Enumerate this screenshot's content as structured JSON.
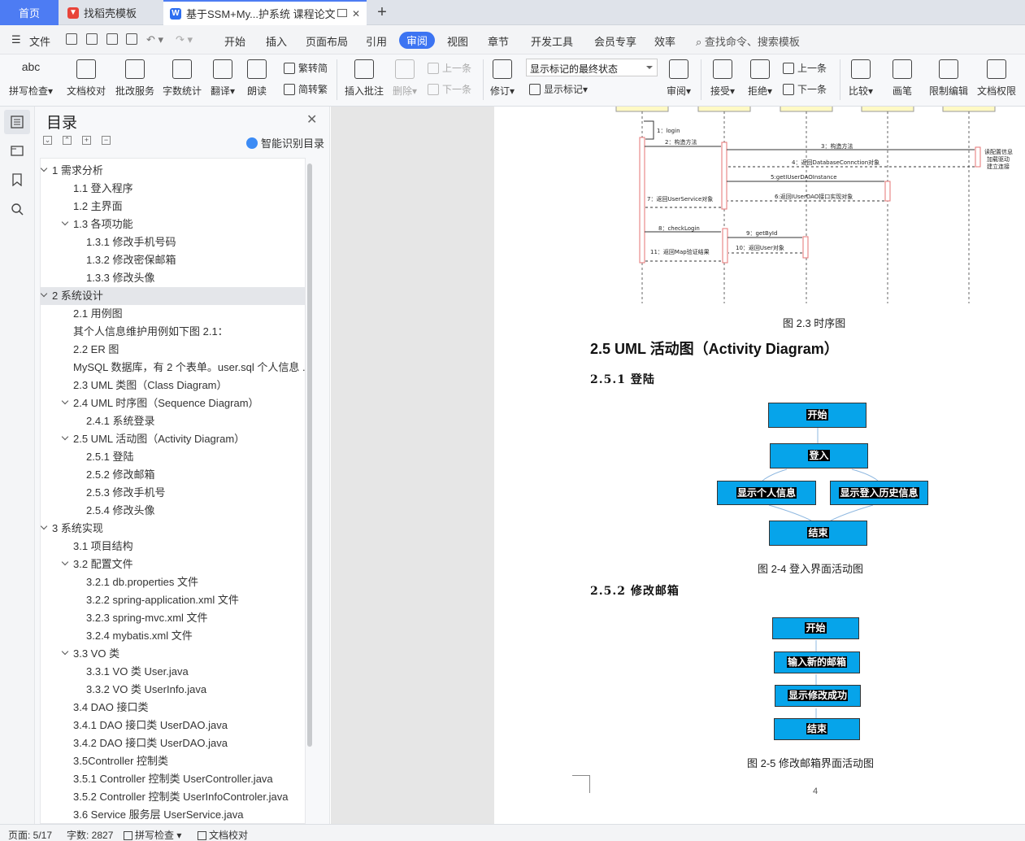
{
  "tabs": {
    "home": "首页",
    "template": "找稻壳模板",
    "doc": "基于SSM+My...护系统 课程论文"
  },
  "menu": {
    "file": "文件",
    "items": [
      "开始",
      "插入",
      "页面布局",
      "引用",
      "审阅",
      "视图",
      "章节",
      "开发工具",
      "会员专享",
      "效率"
    ],
    "search": "查找命令、搜索模板"
  },
  "ribbon": {
    "spell": "拼写检查",
    "proof": "文档校对",
    "batch": "批改服务",
    "wordcount": "字数统计",
    "translate": "翻译",
    "read": "朗读",
    "t2s": "繁转简",
    "s2t": "简转繁",
    "insert_comment": "插入批注",
    "delete": "删除",
    "prev": "上一条",
    "next": "下一条",
    "revise": "修订",
    "markup_state": "显示标记的最终状态",
    "show_markup": "显示标记",
    "review": "审阅",
    "accept": "接受",
    "reject": "拒绝",
    "prev2": "上一条",
    "next2": "下一条",
    "compare": "比较",
    "pen": "画笔",
    "restrict": "限制编辑",
    "permission": "文档权限"
  },
  "toc": {
    "title": "目录",
    "smart": "智能识别目录",
    "items": [
      {
        "label": "1  需求分析",
        "level": 0,
        "caret": true
      },
      {
        "label": "1.1 登入程序",
        "level": 1
      },
      {
        "label": "1.2 主界面",
        "level": 1
      },
      {
        "label": "1.3 各项功能",
        "level": 1,
        "caret": true
      },
      {
        "label": "1.3.1  修改手机号码",
        "level": 2
      },
      {
        "label": "1.3.2  修改密保邮箱",
        "level": 2
      },
      {
        "label": "1.3.3  修改头像",
        "level": 2
      },
      {
        "label": "2  系统设计",
        "level": 0,
        "caret": true,
        "highlight": true
      },
      {
        "label": "2.1 用例图",
        "level": 1
      },
      {
        "label": "其个人信息维护用例如下图 2.1：",
        "level": 1
      },
      {
        "label": "2.2 ER 图",
        "level": 1
      },
      {
        "label": "MySQL 数据库，有 2 个表单。user.sql 个人信息 ...",
        "level": 1
      },
      {
        "label": "2.3 UML 类图（Class Diagram）",
        "level": 1
      },
      {
        "label": "2.4 UML 时序图（Sequence Diagram）",
        "level": 1,
        "caret": true
      },
      {
        "label": "2.4.1  系统登录",
        "level": 2
      },
      {
        "label": "2.5 UML 活动图（Activity Diagram）",
        "level": 1,
        "caret": true
      },
      {
        "label": "2.5.1  登陆",
        "level": 2
      },
      {
        "label": "2.5.2  修改邮箱",
        "level": 2
      },
      {
        "label": "2.5.3  修改手机号",
        "level": 2
      },
      {
        "label": "2.5.4  修改头像",
        "level": 2
      },
      {
        "label": "3  系统实现",
        "level": 0,
        "caret": true
      },
      {
        "label": "3.1  项目结构",
        "level": 1
      },
      {
        "label": "3.2  配置文件",
        "level": 1,
        "caret": true
      },
      {
        "label": "3.2.1 db.properties 文件",
        "level": 2
      },
      {
        "label": "3.2.2 spring-application.xml 文件",
        "level": 2
      },
      {
        "label": "3.2.3 spring-mvc.xml 文件",
        "level": 2
      },
      {
        "label": "3.2.4 mybatis.xml 文件",
        "level": 2
      },
      {
        "label": "3.3 VO 类",
        "level": 1,
        "caret": true
      },
      {
        "label": "3.3.1    VO 类 User.java",
        "level": 2
      },
      {
        "label": "3.3.2    VO 类 UserInfo.java",
        "level": 2
      },
      {
        "label": "3.4 DAO 接口类",
        "level": 1
      },
      {
        "label": "3.4.1 DAO 接口类 UserDAO.java",
        "level": 1
      },
      {
        "label": "3.4.2 DAO 接口类 UserDAO.java",
        "level": 1
      },
      {
        "label": "3.5Controller 控制类",
        "level": 1
      },
      {
        "label": "3.5.1 Controller 控制类 UserController.java",
        "level": 1
      },
      {
        "label": "3.5.2 Controller 控制类 UserInfoControler.java",
        "level": 1
      },
      {
        "label": "3.6 Service 服务层 UserService.java",
        "level": 1
      }
    ]
  },
  "doc": {
    "seq_messages": [
      "1：login",
      "2：构造方法",
      "3：构造方法",
      "4：返回DatabaseConnction对象",
      "5:getIUserDAOInstance",
      "6:返回IUserDAO接口实现对象",
      "7：返回UserService对象",
      "8：checkLogin",
      "9：getById",
      "10：返回User对象",
      "11：返回Map验证结果"
    ],
    "seq_note": [
      "读配置信息",
      "加载驱动",
      "建立连接"
    ],
    "fig23": "图 2.3 时序图",
    "h25": "2.5 UML 活动图（Activity Diagram）",
    "h251": "2.5.1  登陆",
    "act1": {
      "start": "开始",
      "login": "登入",
      "left": "显示个人信息",
      "right": "显示登入历史信息",
      "end": "结束"
    },
    "fig24": "图 2-4  登入界面活动图",
    "h252": "2.5.2  修改邮箱",
    "act2": {
      "start": "开始",
      "input": "输入新的邮箱",
      "success": "显示修改成功",
      "end": "结束"
    },
    "fig25": "图 2-5  修改邮箱界面活动图",
    "pagenum": "4"
  },
  "status": {
    "page": "页面: 5/17",
    "words": "字数: 2827",
    "spell": "拼写检查",
    "proof": "文档校对"
  }
}
